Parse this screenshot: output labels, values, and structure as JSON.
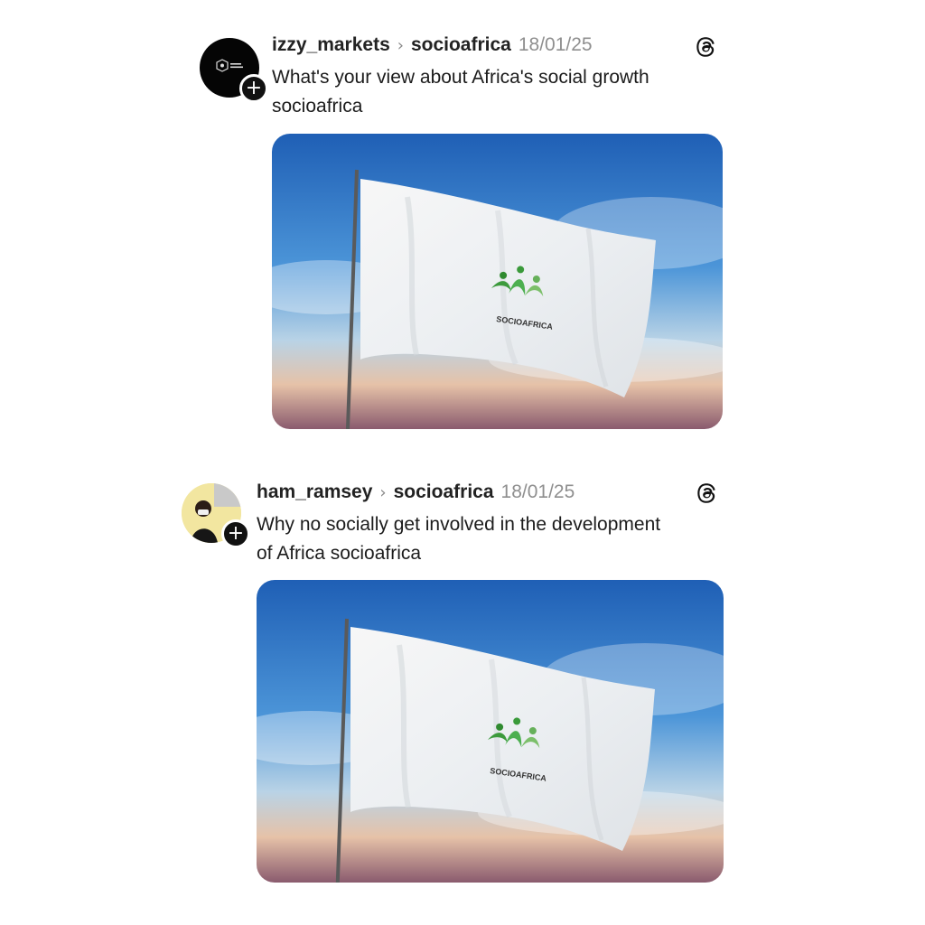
{
  "posts": [
    {
      "username": "izzy_markets",
      "separator": "›",
      "community": "socioafrica",
      "date": "18/01/25",
      "caption_line1": "What's your view about Africa's social growth",
      "caption_line2": "socioafrica",
      "avatar_icon": "izzy-markets-logo-icon",
      "flag_logo_text": "SOCIOAFRICA",
      "follow_symbol": "+"
    },
    {
      "username": "ham_ramsey",
      "separator": "›",
      "community": "socioafrica",
      "date": "18/01/25",
      "caption_line1": "Why no socially get involved in the development",
      "caption_line2": "of Africa socioafrica",
      "avatar_icon": "profile-photo-icon",
      "flag_logo_text": "SOCIOAFRICA",
      "follow_symbol": "+"
    }
  ],
  "colors": {
    "text": "#1a1a1a",
    "muted": "#8f8f8f",
    "sky_top": "#2a6fc0",
    "sky_bottom": "#f0a070",
    "logo_green": "#3c9a3c"
  }
}
